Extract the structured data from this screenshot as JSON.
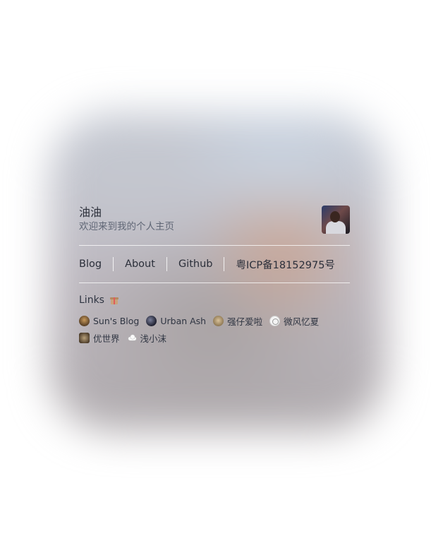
{
  "profile": {
    "name": "油油",
    "subtitle": "欢迎来到我的个人主页"
  },
  "nav": {
    "items": [
      "Blog",
      "About",
      "Github",
      "粤ICP备18152975号"
    ]
  },
  "links": {
    "title": "Links",
    "friends": [
      "Sun's Blog",
      "Urban Ash",
      "强仔爱啦",
      "微风忆夏",
      "优世界",
      "浅小沫"
    ]
  }
}
